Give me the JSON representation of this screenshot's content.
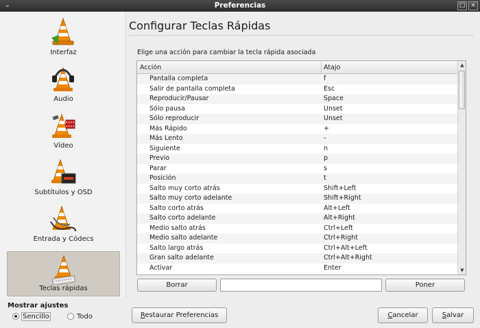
{
  "window": {
    "title": "Preferencias",
    "maximize_glyph": "□",
    "close_glyph": "×",
    "menu_glyph": "⌄"
  },
  "sidebar": {
    "items": [
      {
        "label": "Interfaz",
        "icon": "vlc-cone-icon",
        "active": false
      },
      {
        "label": "Audio",
        "icon": "vlc-cone-headphones-icon",
        "active": false
      },
      {
        "label": "Vídeo",
        "icon": "vlc-cone-film-icon",
        "active": false
      },
      {
        "label": "Subtítulos y OSD",
        "icon": "vlc-cone-subtitles-icon",
        "active": false
      },
      {
        "label": "Entrada y Códecs",
        "icon": "vlc-cone-cables-icon",
        "active": false
      },
      {
        "label": "Teclas rápidas",
        "icon": "vlc-cone-keyboard-icon",
        "active": true
      }
    ],
    "mostrar_ajustes": "Mostrar ajustes",
    "radio_sencillo": "Sencillo",
    "radio_todo": "Todo",
    "selected": "Sencillo"
  },
  "main": {
    "heading": "Configurar Teclas Rápidas",
    "instructions": "Elige una acción para cambiar la tecla rápida asociada",
    "table": {
      "col_accion": "Acción",
      "col_atajo": "Atajo",
      "rows": [
        [
          "Pantalla completa",
          "f"
        ],
        [
          "Salir de pantalla completa",
          "Esc"
        ],
        [
          "Reproducir/Pausar",
          "Space"
        ],
        [
          "Sólo pausa",
          "Unset"
        ],
        [
          "Sólo reproducir",
          "Unset"
        ],
        [
          "Más Rápido",
          "+"
        ],
        [
          "Más Lento",
          "-"
        ],
        [
          "Siguiente",
          "n"
        ],
        [
          "Previo",
          "p"
        ],
        [
          "Parar",
          "s"
        ],
        [
          "Posición",
          "t"
        ],
        [
          "Salto muy corto atrás",
          "Shift+Left"
        ],
        [
          "Salto muy corto adelante",
          "Shift+Right"
        ],
        [
          "Salto corto atrás",
          "Alt+Left"
        ],
        [
          "Salto corto adelante",
          "Alt+Right"
        ],
        [
          "Medio salto atrás",
          "Ctrl+Left"
        ],
        [
          "Medio salto adelante",
          "Ctrl+Right"
        ],
        [
          "Salto largo atrás",
          "Ctrl+Alt+Left"
        ],
        [
          "Gran salto adelante",
          "Ctrl+Alt+Right"
        ],
        [
          "Activar",
          "Enter"
        ]
      ]
    },
    "borrar_label": "Borrar",
    "shortcut_value": "",
    "poner_label": "Poner"
  },
  "footer": {
    "restaurar_first": "R",
    "restaurar_rest": "estaurar Preferencias",
    "cancelar_first": "C",
    "cancelar_rest": "ancelar",
    "salvar_first": "S",
    "salvar_rest": "alvar"
  },
  "scrollbar": {
    "up_glyph": "▲",
    "down_glyph": "▼"
  }
}
